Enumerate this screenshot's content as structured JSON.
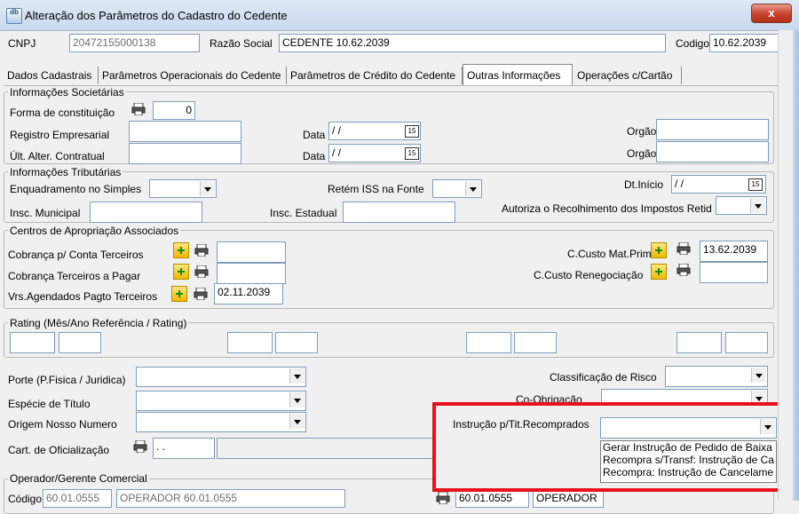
{
  "window": {
    "title": "Alteração dos Parâmetros do Cadastro do Cedente",
    "close_label": "x",
    "icon_text": "db"
  },
  "header": {
    "cnpj_label": "CNPJ",
    "cnpj_value": "20472155000138",
    "razao_label": "Razão Social",
    "razao_value": "CEDENTE 10.62.2039",
    "codigo_label": "Codigo",
    "codigo_value": "10.62.2039"
  },
  "tabs": [
    {
      "label": "Dados Cadastrais"
    },
    {
      "label": "Parâmetros Operacionais do Cedente"
    },
    {
      "label": "Parâmetros de Crédito do Cedente"
    },
    {
      "label": "Outras Informações"
    },
    {
      "label": "Operações c/Cartão"
    }
  ],
  "societarias": {
    "legend": "Informações Societárias",
    "forma_label": "Forma de constituição",
    "forma_value": "0",
    "registro_label": "Registro Empresarial",
    "ult_label": "Últ. Alter. Contratual",
    "data_label": "Data",
    "date_placeholder": "/ /",
    "orgao_label": "Orgão"
  },
  "tributarias": {
    "legend": "Informações Tributárias",
    "enquadramento_label": "Enquadramento no Simples",
    "retem_label": "Retém ISS na Fonte",
    "dtinicio_label": "Dt.Início",
    "dtinicio_value": "/ /",
    "insc_municipal_label": "Insc. Municipal",
    "insc_estadual_label": "Insc. Estadual",
    "autoriza_label": "Autoriza o Recolhimento  dos Impostos Retid"
  },
  "centros": {
    "legend": "Centros de Apropriação Associados",
    "cobranca_conta_label": "Cobrança p/ Conta Terceiros",
    "cobranca_pagar_label": "Cobrança Terceiros a Pagar",
    "vrs_label": "Vrs.Agendados Pagto Terceiros",
    "vrs_value": "02.11.2039",
    "custo_mat_label": "C.Custo Mat.Prima",
    "custo_mat_value": "13.62.2039",
    "custo_reneg_label": "C.Custo Renegociação"
  },
  "rating": {
    "legend": "Rating (Mês/Ano Referência / Rating)"
  },
  "lower": {
    "porte_label": "Porte (P.Fisica / Juridica)",
    "especie_label": "Espécie de Título",
    "origem_label": "Origem Nosso Numero",
    "cart_label": "Cart. de Oficialização",
    "cart_value": ". .",
    "classificacao_label": "Classificação de Risco",
    "coobrigacao_label": "Co-Obrigação",
    "instrucao_label": "Instrução p/Tit.Recomprados",
    "instrucao_options": [
      "Gerar Instrução de Pedido de Baixa",
      "Recompra s/Transf: Instrução de Ca",
      "Recompra: Instrução de Cancelame"
    ]
  },
  "operador": {
    "legend": "Operador/Gerente Comercial",
    "codigo_label": "Código",
    "codigo_value": "60.01.0555",
    "nome_value": "OPERADOR 60.01.0555",
    "right_codigo_value": "60.01.0555",
    "right_nome_value": "OPERADOR"
  },
  "colors": {
    "highlight": "#e8121c",
    "titlebar": "#c9d9ee"
  }
}
